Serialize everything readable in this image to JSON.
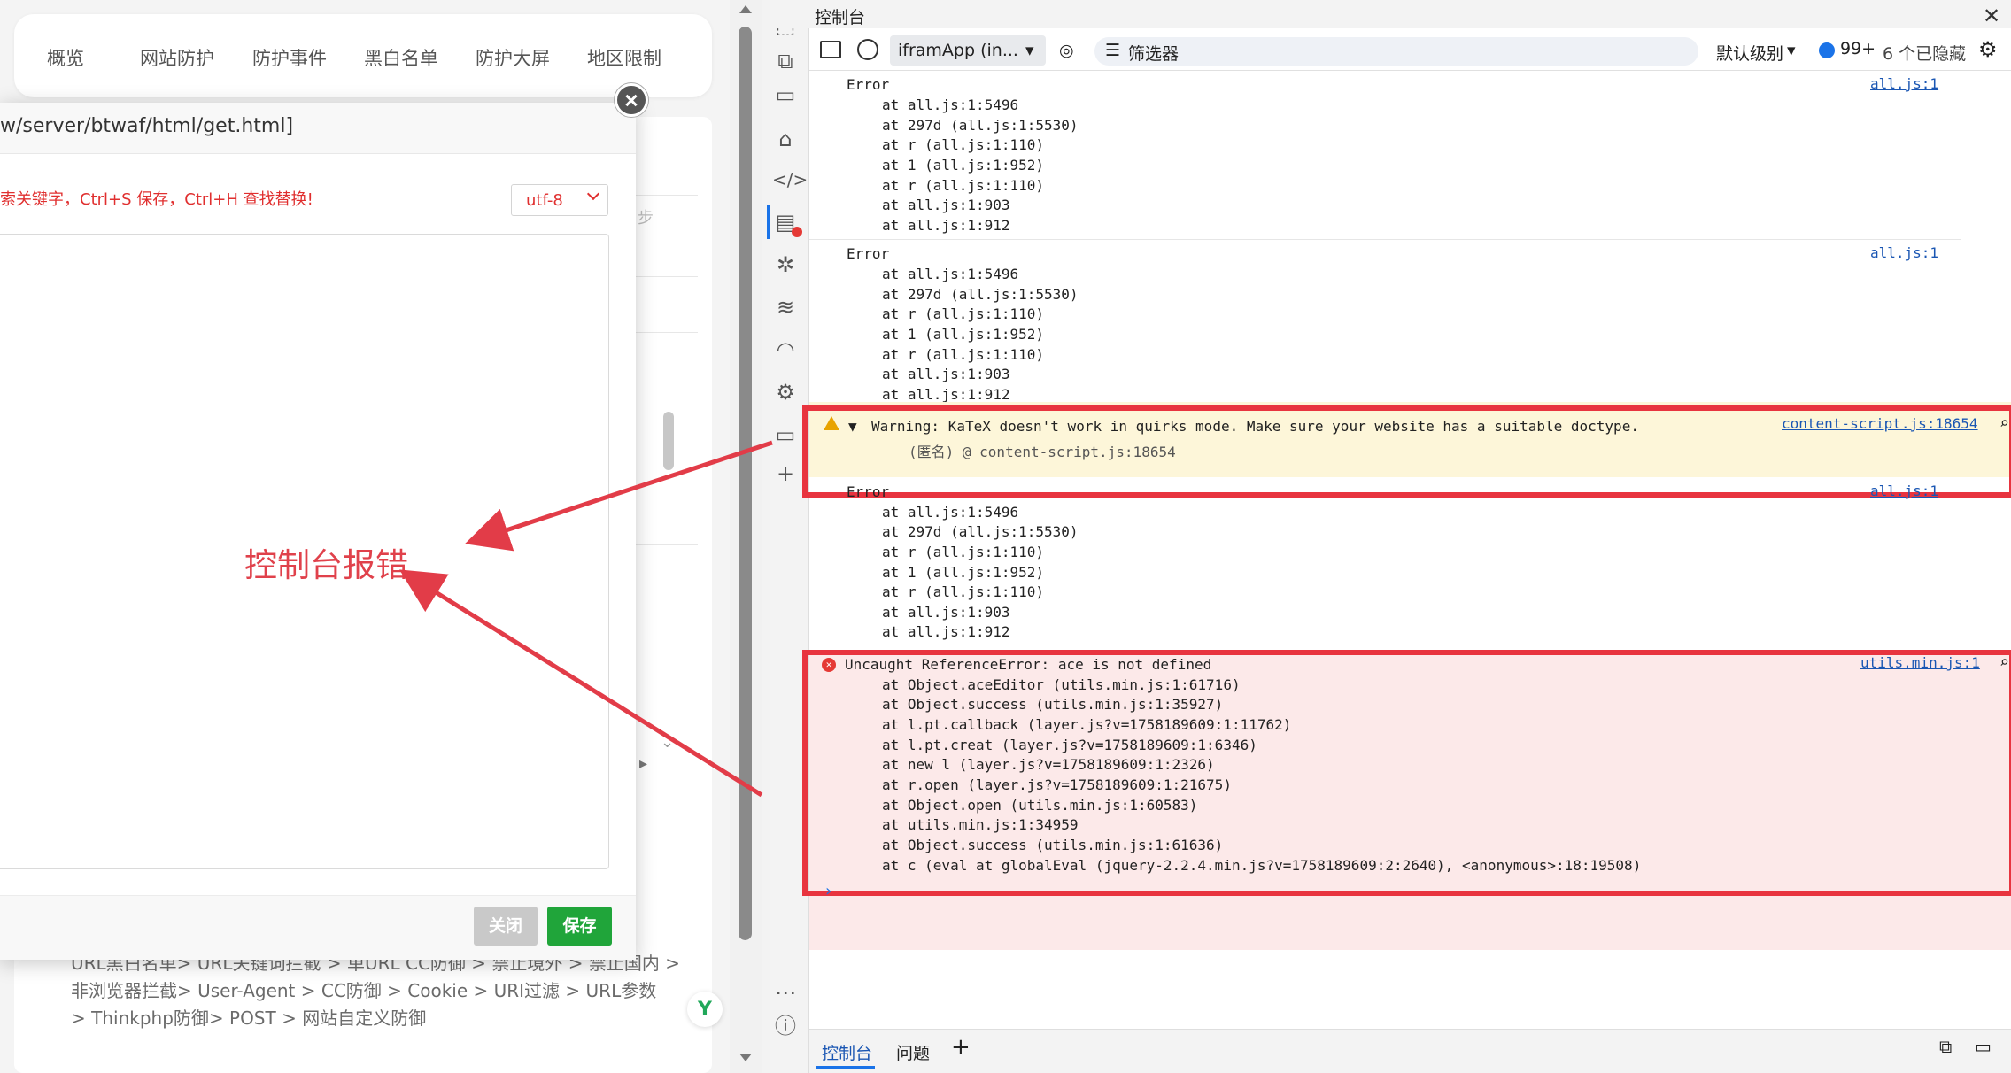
{
  "web": {
    "nav": [
      "概览",
      "网站防护",
      "防护事件",
      "黑白名单",
      "防护大屏",
      "地区限制"
    ],
    "bg_texts": [
      "URL黑白名单> URL关键词拦截 > 单URL CC防御 > 禁止境外 > 禁止国内 >",
      "非浏览器拦截> User-Agent > CC防御 > Cookie > URI过滤 > URL参数",
      "> Thinkphp防御> POST > 网站自定义防御"
    ],
    "modal": {
      "title": "w/server/btwaf/html/get.html]",
      "hint": "索关键字，Ctrl+S 保存，Ctrl+H 查找替换!",
      "encoding": "utf-8",
      "close_label": "关闭",
      "save_label": "保存"
    },
    "annotation": "控制台报错"
  },
  "devtools": {
    "title": "控制台",
    "context": "iframApp (in...",
    "filter_label": "筛选器",
    "level_label": "默认级别",
    "issues_count": "99+",
    "hidden_label": "6 个已隐藏",
    "bottom_tabs": [
      "控制台",
      "问题"
    ],
    "error_label": "Error",
    "stack1": [
      "at all.js:1:5496",
      "at 297d (all.js:1:5530)",
      "at r (all.js:1:110)",
      "at 1 (all.js:1:952)",
      "at r (all.js:1:110)",
      "at all.js:1:903",
      "at all.js:1:912"
    ],
    "all_js_link": "all.js:1",
    "warning": {
      "text": "Warning: KaTeX doesn't work in quirks mode. Make sure your website has a suitable doctype.",
      "source": "content-script.js:18654",
      "sub": "(匿名) @ content-script.js:18654"
    },
    "uncaught": {
      "text": "Uncaught ReferenceError: ace is not defined",
      "source": "utils.min.js:1",
      "stack": [
        "at Object.aceEditor (utils.min.js:1:61716)",
        "at Object.success (utils.min.js:1:35927)",
        "at l.pt.callback (layer.js?v=1758189609:1:11762)",
        "at l.pt.creat (layer.js?v=1758189609:1:6346)",
        "at new l (layer.js?v=1758189609:1:2326)",
        "at r.open (layer.js?v=1758189609:1:21675)",
        "at Object.open (utils.min.js:1:60583)",
        "at utils.min.js:1:34959",
        "at Object.success (utils.min.js:1:61636)",
        "at c (eval at globalEval (jquery-2.2.4.min.js?v=1758189609:2:2640), <anonymous>:18:19508)"
      ]
    }
  }
}
